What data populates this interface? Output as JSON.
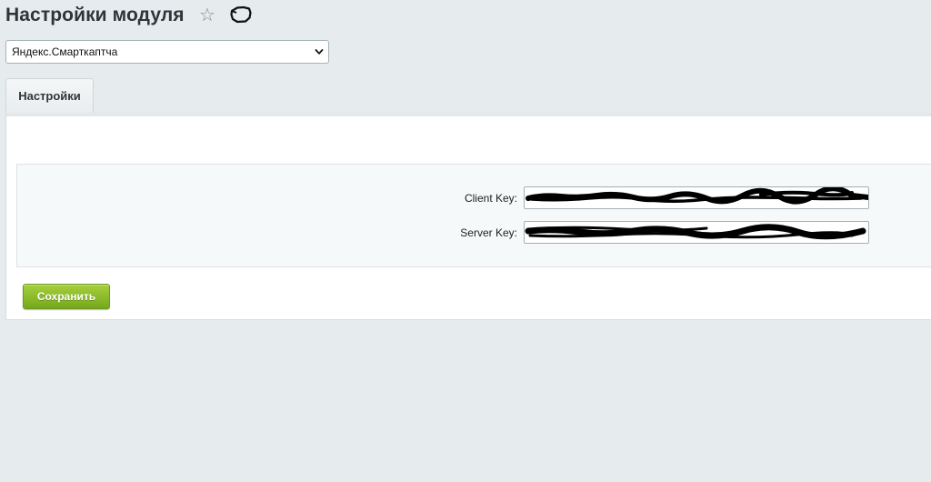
{
  "header": {
    "title": "Настройки модуля",
    "favorite_icon": "star-outline-icon",
    "extra_icon": "hand-pointer-icon"
  },
  "module_select": {
    "selected": "Яндекс.Смарткаптча",
    "icon": "chevron-down-icon"
  },
  "tabs": [
    {
      "label": "Настройки",
      "active": true
    }
  ],
  "settings": {
    "fields": [
      {
        "label": "Client Key:",
        "value_redacted": true
      },
      {
        "label": "Server Key:",
        "value_redacted": true
      }
    ]
  },
  "actions": {
    "save_label": "Сохранить"
  },
  "colors": {
    "page_background": "#e6ebed",
    "panel_background": "#ffffff",
    "settings_background": "#f5f9f9",
    "save_button_top": "#a6cf3d",
    "save_button_bottom": "#76a81c",
    "redaction": "#000000"
  }
}
